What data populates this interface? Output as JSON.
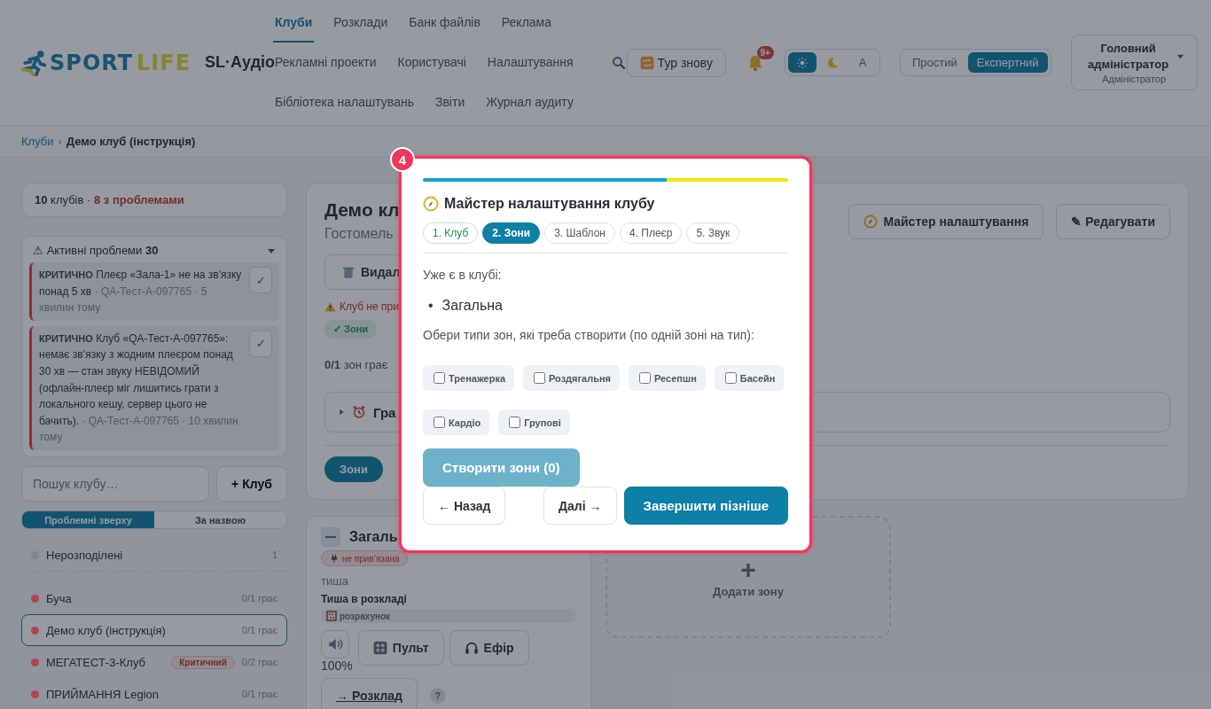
{
  "header": {
    "logo": {
      "word_1": "SPORT",
      "word_2": "LIFE"
    },
    "app_name": "SL·Аудіо",
    "nav_rows": [
      {
        "items": [
          {
            "label": "Клуби",
            "selected": true
          },
          {
            "label": "Розклади",
            "selected": false
          },
          {
            "label": "Банк файлів",
            "selected": false
          },
          {
            "label": "Реклама",
            "selected": false
          }
        ]
      },
      {
        "items": [
          {
            "label": "Рекламні проекти",
            "selected": false
          },
          {
            "label": "Користувачі",
            "selected": false
          },
          {
            "label": "Налаштування",
            "selected": false
          }
        ]
      },
      {
        "items": [
          {
            "label": "Бібліотека налаштувань",
            "selected": false
          },
          {
            "label": "Звіти",
            "selected": false
          },
          {
            "label": "Журнал аудиту",
            "selected": false
          }
        ]
      }
    ],
    "tour_button": "Тур знову",
    "notification_count": "9+",
    "theme_options": [
      {
        "kind": "sun",
        "selected": true
      },
      {
        "kind": "moon",
        "selected": false
      },
      {
        "kind": "letter",
        "label": "A",
        "selected": false
      }
    ],
    "mode_options": [
      {
        "label": "Простий",
        "selected": false
      },
      {
        "label": "Експертний",
        "selected": true
      }
    ],
    "user": {
      "name": "Головний адміністратор",
      "role": "Адміністратор"
    }
  },
  "breadcrumb": {
    "separator": "›",
    "items": [
      {
        "kind": "link",
        "label": "Клуби"
      },
      {
        "kind": "current",
        "label": "Демо клуб (інструкція)"
      }
    ]
  },
  "sidebar": {
    "summary": {
      "count": "10",
      "count_label": "клубів",
      "separator": "·",
      "problems": "8 з проблемами"
    },
    "issues": {
      "icon": "⚠",
      "title": "Активні проблеми",
      "count": "30",
      "expanded": true,
      "items": [
        {
          "severity": "КРИТИЧНО",
          "text": "Плеєр «Зала-1» не на зв'язку понад 5 хв",
          "meta": "· QA-Тест-A-097765 · 5 хвилин тому",
          "dismiss": "✓"
        },
        {
          "severity": "КРИТИЧНО",
          "text": "Клуб «QA-Тест-A-097765»: немає зв’язку з жодним плеєром понад 30 хв — стан звуку НЕВІДОМИЙ (офлайн-плеєр міг лишитись грати з локального кешу, сервер цього не бачить).",
          "meta": "· QA-Тест-A-097765 · 10 хвилин тому",
          "dismiss": "✓"
        }
      ]
    },
    "search": {
      "placeholder": "Пошук клубу…"
    },
    "add_button": "+ Клуб",
    "sort_tabs": [
      {
        "label": "Проблемні зверху",
        "selected": true
      },
      {
        "label": "За назвою",
        "selected": false
      }
    ],
    "clubs": [
      {
        "kind": "group",
        "name": "Нерозподілені",
        "count": "1",
        "color": "#7e8893",
        "selected": false
      },
      {
        "kind": "club",
        "name": "Буча",
        "status": "0/1 грає",
        "color": "#b0454a",
        "selected": false
      },
      {
        "kind": "club",
        "name": "Демо клуб (інструкція)",
        "status": "0/1 грає",
        "color": "#b0454a",
        "selected": true
      },
      {
        "kind": "club",
        "name": "МЕГАТЕСТ-3-Клуб",
        "badge": "Критичний",
        "status": "0/2 грає",
        "color": "#b0454a",
        "selected": false
      },
      {
        "kind": "club",
        "name": "ПРИЙМАННЯ Legion",
        "status": "0/1 грає",
        "color": "#b0454a",
        "selected": false
      }
    ]
  },
  "club": {
    "title": "Демо кл",
    "city": "Гостомель",
    "wizard_button": "Майстер налаштування",
    "edit_button": "✎ Редагувати",
    "delete_button": "Видал",
    "warning": "Клуб не при",
    "chips": [
      {
        "label": "✓ Зони",
        "done": true
      }
    ],
    "zones_playing": "**0/1** зон грає",
    "schedule": {
      "label": "Гра",
      "expanded": false
    },
    "tabs": [
      {
        "label": "Зони",
        "selected": true
      }
    ]
  },
  "zone": {
    "title": "Загаль",
    "binding": "не прив’язана",
    "status": "тиша",
    "schedule_state": "Тиша в розкладі",
    "calc": "розрахунок",
    "volume": "100%",
    "buttons": [
      {
        "kind": "remote",
        "label": "Пульт"
      },
      {
        "kind": "air",
        "label": "Ефір"
      }
    ],
    "schedule_link": "→ Розклад",
    "help": "?"
  },
  "add_zone": {
    "icon": "+",
    "label": "Додати зону"
  },
  "wizard": {
    "badge": "4",
    "progress": {
      "level": 0.667
    },
    "title": "Майстер налаштування клубу",
    "steps": [
      {
        "label": "1. Клуб",
        "selected": false,
        "done": true
      },
      {
        "label": "2. Зони",
        "selected": true,
        "done": false
      },
      {
        "label": "3. Шаблон",
        "selected": false,
        "done": false
      },
      {
        "label": "4. Плеєр",
        "selected": false,
        "done": false
      },
      {
        "label": "5. Звук",
        "selected": false,
        "done": false
      }
    ],
    "existing_label": "Уже є в клубі:",
    "existing": [
      {
        "bullet": "•",
        "label": "Загальна"
      }
    ],
    "prompt": "Обери типи зон, які треба створити (по одній зоні на тип):",
    "zone_types": [
      {
        "label": "Тренажерка",
        "checked": false
      },
      {
        "label": "Роздягальня",
        "checked": false
      },
      {
        "label": "Ресепшн",
        "checked": false
      },
      {
        "label": "Басейн",
        "checked": false
      },
      {
        "label": "Кардіо",
        "checked": false
      },
      {
        "label": "Групові",
        "checked": false
      }
    ],
    "create_button": {
      "label": "Створити зони (0)",
      "disabled": true
    },
    "back_button": "← Назад",
    "next_button": "Далі →",
    "finish_button": "Завершити пізніше"
  }
}
